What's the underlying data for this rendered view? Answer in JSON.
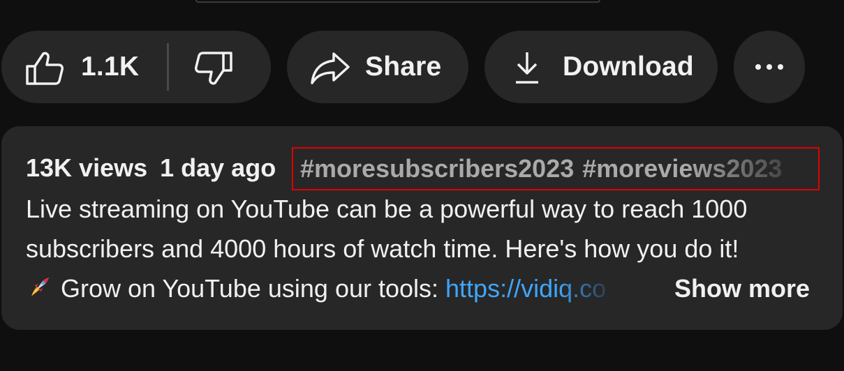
{
  "actions": {
    "like_count": "1.1K",
    "share_label": "Share",
    "download_label": "Download"
  },
  "description": {
    "views": "13K views",
    "age": "1 day ago",
    "hashtags": [
      "#moresubscribers2023",
      "#moreviews2023"
    ],
    "lines": [
      "Live streaming on YouTube can be a powerful way to reach 1000",
      "subscribers and 4000 hours of watch time. Here's how you do it!"
    ],
    "line3_text": "Grow on YouTube using our tools: ",
    "link_text": "https://vidiq.co",
    "show_more": "Show more"
  },
  "icons": {
    "like": "thumbs-up-icon",
    "dislike": "thumbs-down-icon",
    "share": "share-arrow-icon",
    "download": "download-icon",
    "more": "more-horizontal-icon",
    "rocket": "rocket-emoji"
  },
  "colors": {
    "background": "#0f0f0f",
    "surface": "#272727",
    "text": "#f1f1f1",
    "hashtag": "#aaaaaa",
    "link": "#3ea6ff",
    "highlight_border": "#e00000"
  }
}
